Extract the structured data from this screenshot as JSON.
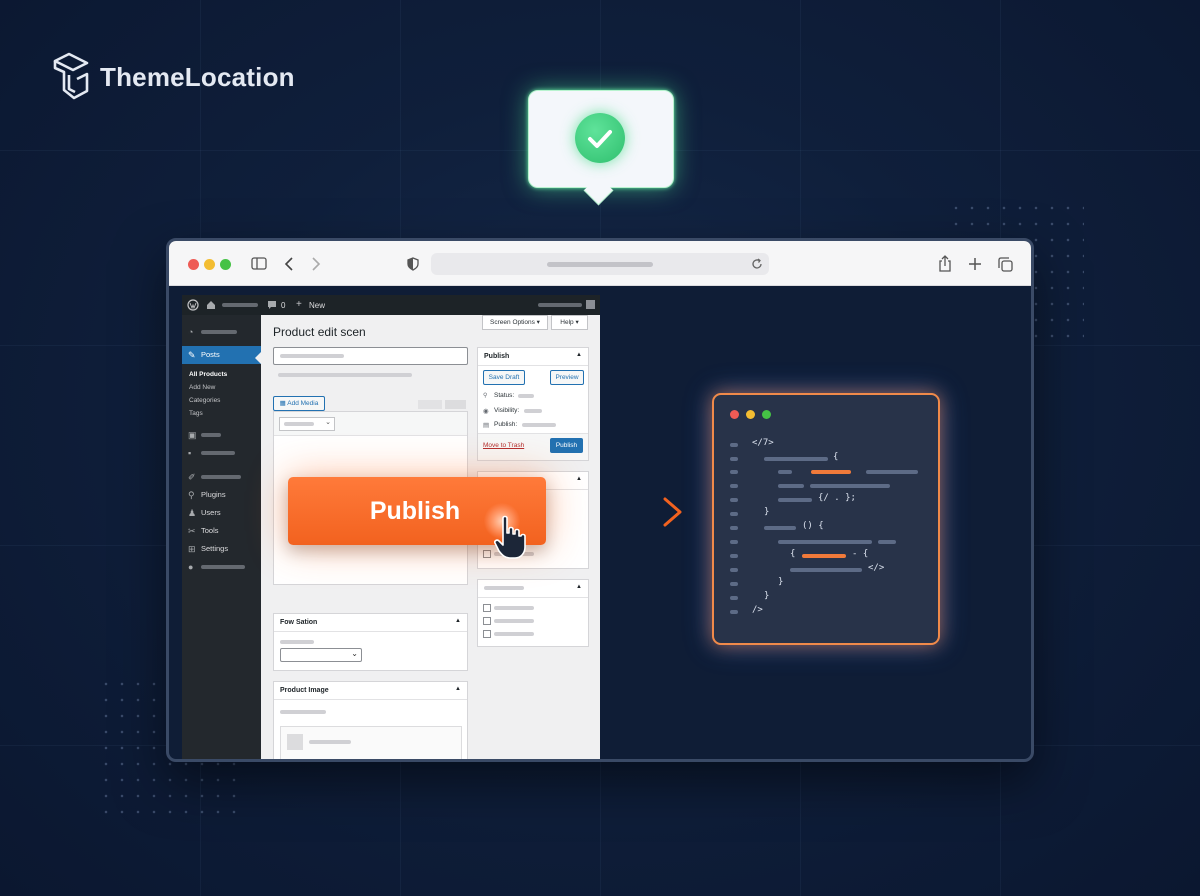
{
  "brand": {
    "name": "ThemeLocation"
  },
  "wp": {
    "admin_bar": {
      "comments_count": "0",
      "new_label": "New"
    },
    "sidebar": {
      "posts_label": "Posts",
      "submenu": [
        "All Products",
        "Add New",
        "Categories",
        "Tags"
      ],
      "items": [
        "Plugins",
        "Users",
        "Tools",
        "Settings"
      ]
    },
    "header": {
      "screen_options": "Screen Options",
      "help": "Help"
    },
    "page_title": "Product edit scen",
    "add_media": "Add Media",
    "publish_box": {
      "title": "Publish",
      "save_draft": "Save Draft",
      "preview": "Preview",
      "status_label": "Status:",
      "visibility_label": "Visibility:",
      "publish_label": "Publish:",
      "trash_link": "Move to Trash",
      "publish_button": "Publish"
    },
    "section_box": {
      "title": "Fow Sation"
    },
    "product_image_box": {
      "title": "Product Image"
    }
  },
  "overlay": {
    "publish_cta": "Publish"
  },
  "code_window": {
    "lines": [
      "</7>",
      "{",
      "{/ . };",
      "}",
      "() {",
      "{",
      "</>",
      "}",
      "}",
      "/>"
    ]
  },
  "colors": {
    "accent_orange": "#f2621f",
    "wp_blue": "#2271b1",
    "success_green": "#2fbf6e",
    "code_glow_blue": "#3c8cff"
  }
}
